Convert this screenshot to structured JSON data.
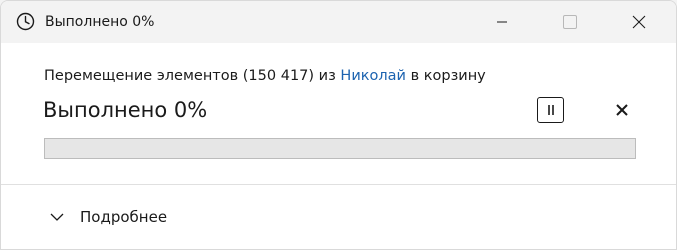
{
  "window": {
    "title": "Выполнено 0%",
    "icon": "clock-icon",
    "controls": {
      "minimize_icon": "minimize-icon",
      "maximize_icon": "maximize-icon",
      "close_icon": "close-icon"
    }
  },
  "operation": {
    "description_prefix": "Перемещение элементов (150 417) из ",
    "source_link": "Николай",
    "description_suffix": " в корзину",
    "status": "Выполнено 0%",
    "progress_percent": 0,
    "pause_icon": "pause-icon",
    "cancel_icon": "cancel-x-icon"
  },
  "details": {
    "label": "Подробнее",
    "expanded": false,
    "icon": "chevron-down-icon"
  },
  "colors": {
    "titlebar_bg": "#f3f3f3",
    "window_bg": "#ffffff",
    "link": "#1c63b0",
    "progress_track": "#e6e6e6",
    "progress_fill": "#06b025"
  }
}
